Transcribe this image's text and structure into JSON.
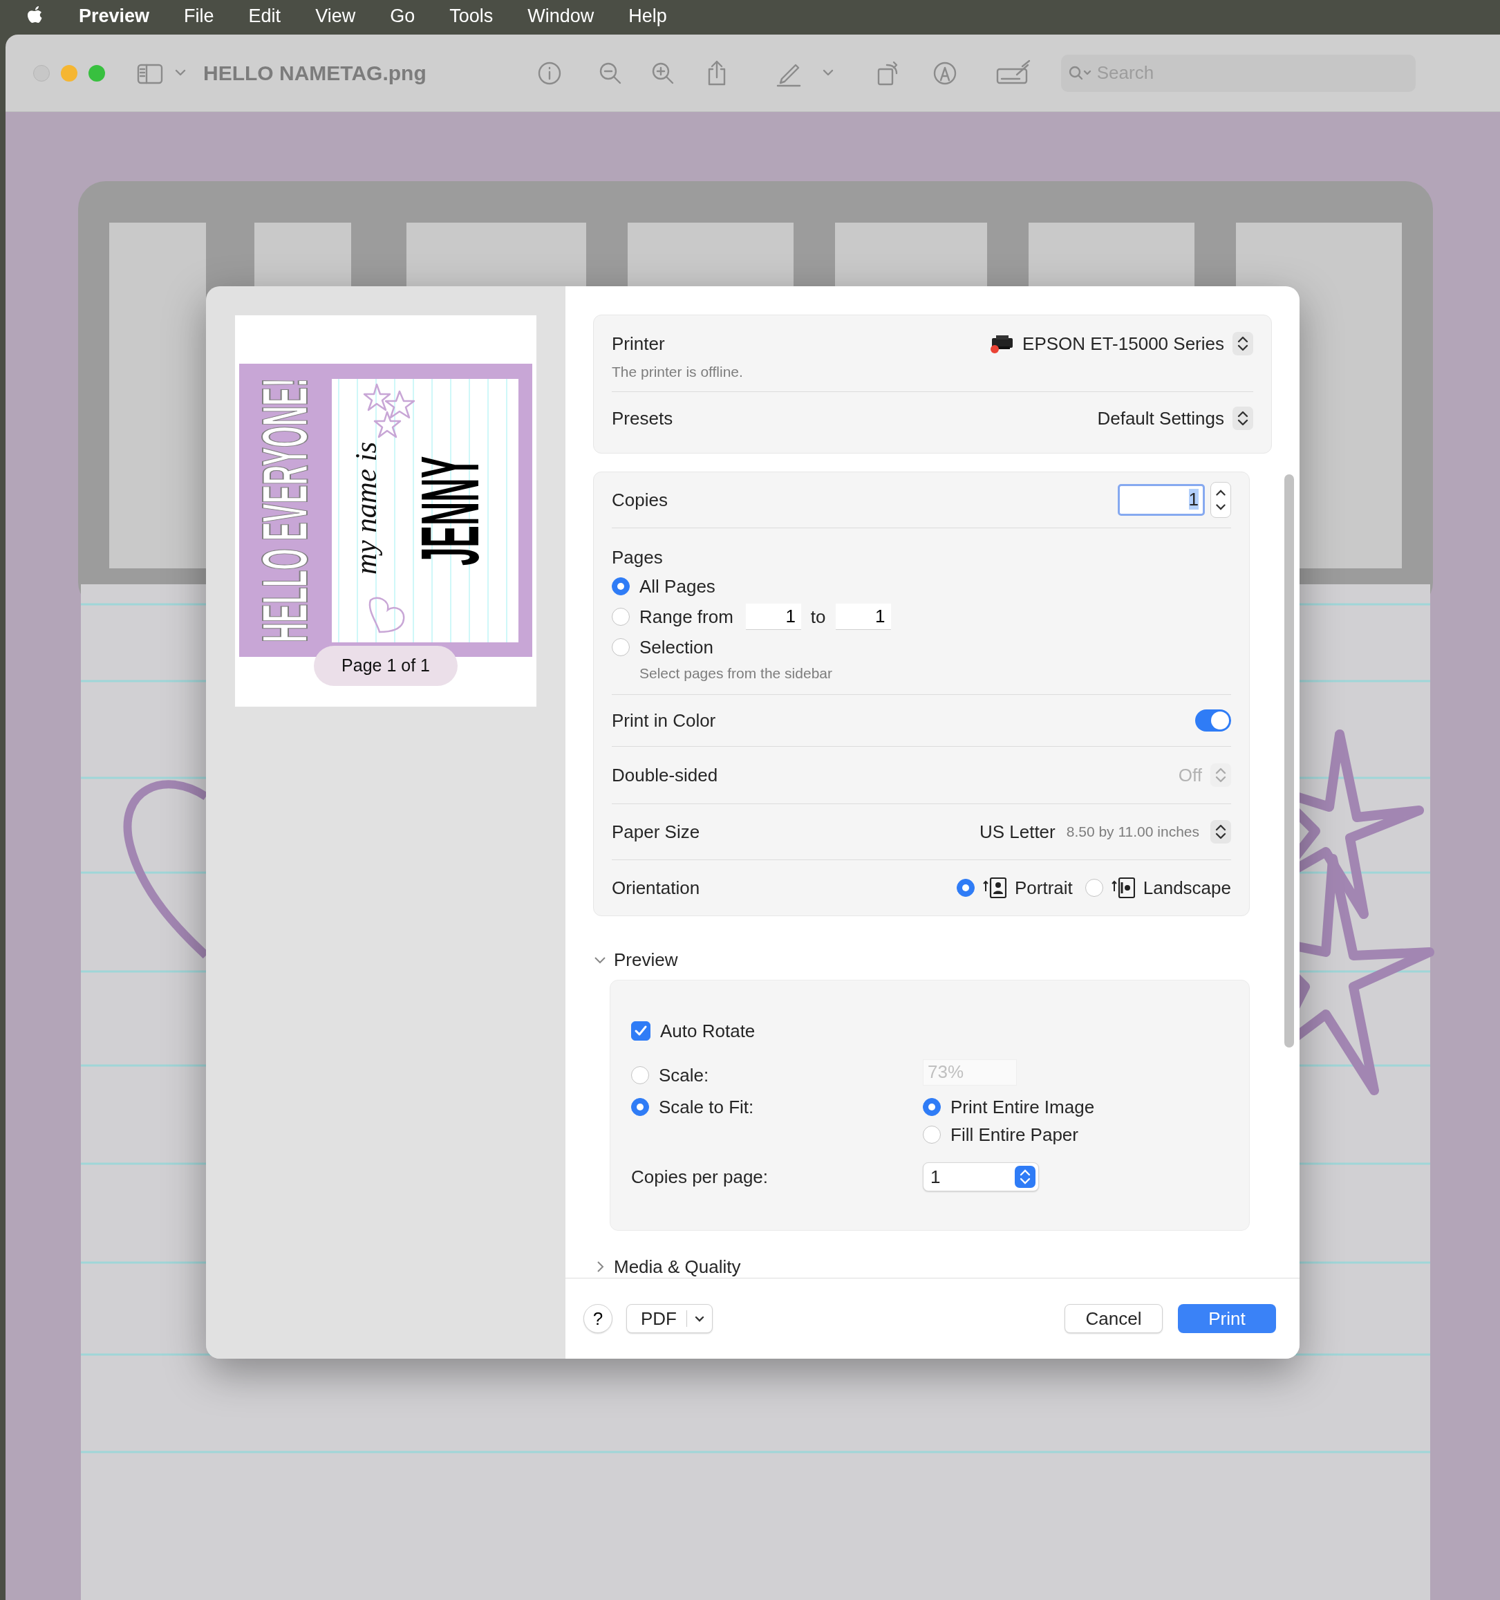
{
  "menu_bar": {
    "app": "Preview",
    "items": [
      "File",
      "Edit",
      "View",
      "Go",
      "Tools",
      "Window",
      "Help"
    ]
  },
  "window": {
    "title": "HELLO NAMETAG.png",
    "search": {
      "placeholder": "Search"
    }
  },
  "print_dialog": {
    "thumbnail": {
      "headline": "HELLO EVERYONE!",
      "subtitle": "my name is",
      "name": "JENNY",
      "page_label": "Page 1 of 1"
    },
    "printer": {
      "label": "Printer",
      "value": "EPSON ET-15000 Series",
      "status": "The printer is offline."
    },
    "presets": {
      "label": "Presets",
      "value": "Default Settings"
    },
    "copies": {
      "label": "Copies",
      "value": "1"
    },
    "pages": {
      "label": "Pages",
      "options": [
        {
          "kind": "plain",
          "label": "All Pages",
          "selected": true
        },
        {
          "kind": "range",
          "label": "Range from",
          "selected": false,
          "from": "1",
          "to_label": "to",
          "to": "1"
        },
        {
          "kind": "hint",
          "label": "Selection",
          "selected": false,
          "hint": "Select pages from the sidebar"
        }
      ]
    },
    "print_in_color": {
      "label": "Print in Color",
      "on": true
    },
    "double_sided": {
      "label": "Double-sided",
      "value": "Off",
      "disabled": true
    },
    "paper_size": {
      "label": "Paper Size",
      "value": "US Letter",
      "detail": "8.50 by 11.00 inches"
    },
    "orientation": {
      "label": "Orientation",
      "options": [
        {
          "label": "Portrait",
          "selected": true
        },
        {
          "label": "Landscape",
          "selected": false
        }
      ]
    },
    "preview_section": {
      "title": "Preview",
      "expanded": true,
      "auto_rotate": {
        "label": "Auto Rotate",
        "checked": true
      },
      "scale_modes": [
        {
          "kind": "scale",
          "label": "Scale:",
          "selected": false,
          "value": "73%"
        },
        {
          "kind": "fit",
          "label": "Scale to Fit:",
          "selected": true,
          "options": [
            {
              "label": "Print Entire Image",
              "selected": true
            },
            {
              "label": "Fill Entire Paper",
              "selected": false
            }
          ]
        }
      ],
      "copies_per_page": {
        "label": "Copies per page:",
        "value": "1"
      }
    },
    "media_section": {
      "title": "Media & Quality",
      "expanded": false
    },
    "footer": {
      "help": "?",
      "pdf": "PDF",
      "cancel": "Cancel",
      "print": "Print"
    }
  }
}
